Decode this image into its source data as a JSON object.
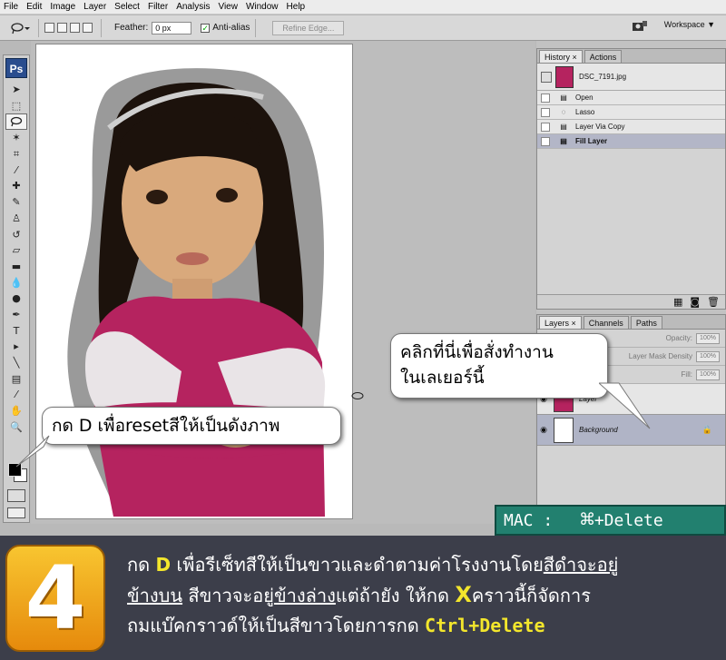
{
  "menu": [
    "File",
    "Edit",
    "Image",
    "Layer",
    "Select",
    "Filter",
    "Analysis",
    "View",
    "Window",
    "Help"
  ],
  "options": {
    "feather_label": "Feather:",
    "feather_value": "0 px",
    "antialias_label": "Anti-alias",
    "refine_label": "Refine Edge...",
    "workspace_label": "Workspace ▼"
  },
  "tools": {
    "logo": "Ps"
  },
  "history": {
    "tabs": [
      "History",
      "Actions"
    ],
    "snapshot": "DSC_7191.jpg",
    "steps": [
      "Open",
      "Lasso",
      "Layer Via Copy",
      "Fill Layer"
    ]
  },
  "layers": {
    "tabs": [
      "Layers",
      "Channels",
      "Paths"
    ],
    "opacity_label": "Opacity:",
    "opacity_value": "100%",
    "mask_density_label": "Layer Mask Density",
    "mask_density_value": "100%",
    "fill_label": "Fill:",
    "fill_value": "100%",
    "rows": [
      {
        "name": "Layer"
      },
      {
        "name": "Background"
      }
    ]
  },
  "callouts": {
    "d_reset": "กด D เพื่อresetสีให้เป็นดังภาพ",
    "click_line1": "คลิกที่นี่เพื่อสั่งทำงาน",
    "click_line2": "ในเลเยอร์นี้"
  },
  "mac": {
    "label": "MAC :",
    "symbol": "⌘",
    "shortcut": "+Delete"
  },
  "step": {
    "number": "4",
    "t1": "กด ",
    "key_d": "D",
    "t2": " เพื่อรีเซ็ทสีให้เป็นขาวและดำตามค่าโรงงานโดย",
    "t3": "สีดำจะอยู่",
    "t4": "ข้างบน",
    "t5": " สีขาวจะอยู่",
    "t6": "ข้างล่าง",
    "t7": "แต่ถ้ายัง ให้กด ",
    "key_x": "X",
    "t8": "คราวนี้ก็จัดการ",
    "t9": "ถมแบ๊คกราวด์ให้เป็นสีขาวโดยการกด ",
    "key_ctrl": "Ctrl+Delete"
  }
}
